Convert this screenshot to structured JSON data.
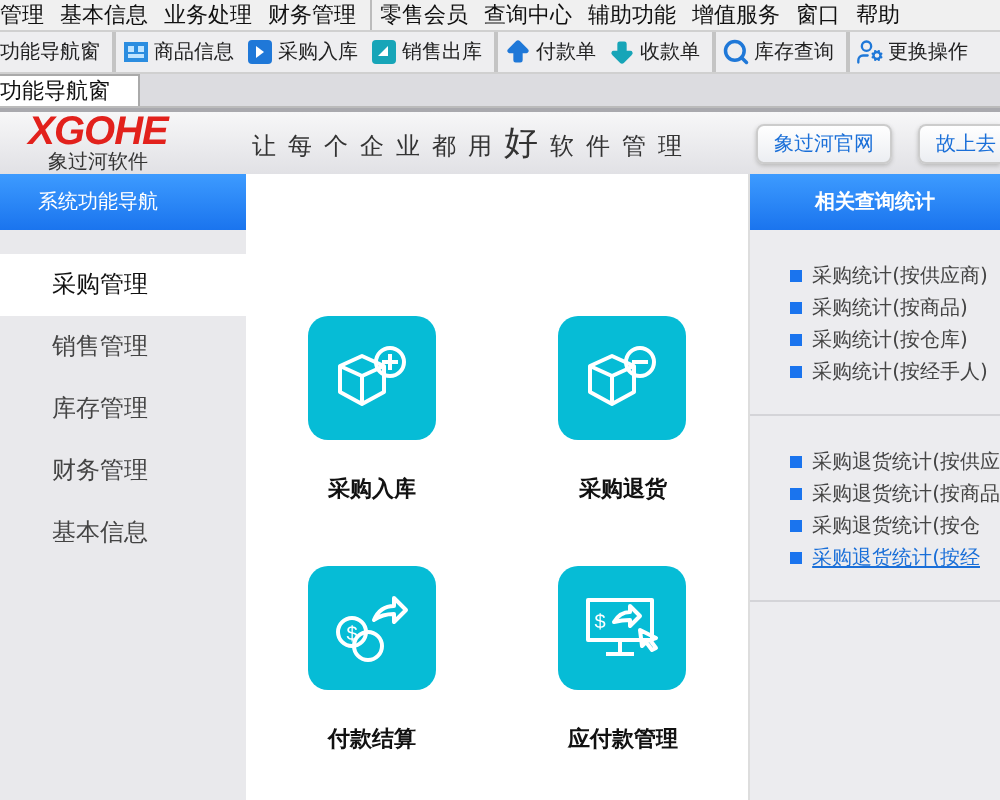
{
  "menu_bar": [
    {
      "label": "管理",
      "group_start": false
    },
    {
      "label": "基本信息",
      "group_start": false
    },
    {
      "label": "业务处理",
      "group_start": false
    },
    {
      "label": "财务管理",
      "group_start": false
    },
    {
      "label": "零售会员",
      "group_start": true
    },
    {
      "label": "查询中心",
      "group_start": false
    },
    {
      "label": "辅助功能",
      "group_start": false
    },
    {
      "label": "增值服务",
      "group_start": false
    },
    {
      "label": "窗口",
      "group_start": false
    },
    {
      "label": "帮助",
      "group_start": false
    }
  ],
  "toolbar": [
    {
      "label": "功能导航窗",
      "kind": "plain",
      "group_start": false
    },
    {
      "label": "商品信息",
      "kind": "goods",
      "group_start": true
    },
    {
      "label": "采购入库",
      "kind": "in",
      "group_start": false
    },
    {
      "label": "销售出库",
      "kind": "out",
      "group_start": false
    },
    {
      "label": "付款单",
      "kind": "up",
      "group_start": true
    },
    {
      "label": "收款单",
      "kind": "down",
      "group_start": false
    },
    {
      "label": "库存查询",
      "kind": "search",
      "group_start": true
    },
    {
      "label": "更换操作",
      "kind": "user",
      "group_start": true
    }
  ],
  "tabs": [
    {
      "label": "功能导航窗",
      "selected": true
    }
  ],
  "header": {
    "logo": "XGOHE",
    "logo_subtitle": "象过河软件",
    "slogan_before": "让每个企业都用",
    "slogan_emphasis": "好",
    "slogan_after": "软件管理",
    "buttons": [
      "象过河官网",
      "故上去"
    ]
  },
  "sidebar": {
    "title": "系统功能导航",
    "items": [
      {
        "label": "采购管理",
        "selected": true
      },
      {
        "label": "销售管理",
        "selected": false
      },
      {
        "label": "库存管理",
        "selected": false
      },
      {
        "label": "财务管理",
        "selected": false
      },
      {
        "label": "基本信息",
        "selected": false
      }
    ]
  },
  "tiles": [
    {
      "label": "采购入库",
      "kind": "box-plus"
    },
    {
      "label": "采购退货",
      "kind": "box-minus"
    },
    {
      "label": "付款结算",
      "kind": "coins",
      "symbol": "$"
    },
    {
      "label": "应付款管理",
      "kind": "monitor",
      "symbol": "$"
    }
  ],
  "related": {
    "title": "相关查询统计",
    "groups": [
      [
        {
          "label": "采购统计(按供应商)",
          "selected": false
        },
        {
          "label": "采购统计(按商品)",
          "selected": false
        },
        {
          "label": "采购统计(按仓库)",
          "selected": false
        },
        {
          "label": "采购统计(按经手人)",
          "selected": false
        }
      ],
      [
        {
          "label": "采购退货统计(按供应",
          "selected": false
        },
        {
          "label": "采购退货统计(按商品",
          "selected": false
        },
        {
          "label": "采购退货统计(按仓",
          "selected": false
        },
        {
          "label": "采购退货统计(按经",
          "selected": true
        }
      ]
    ]
  }
}
